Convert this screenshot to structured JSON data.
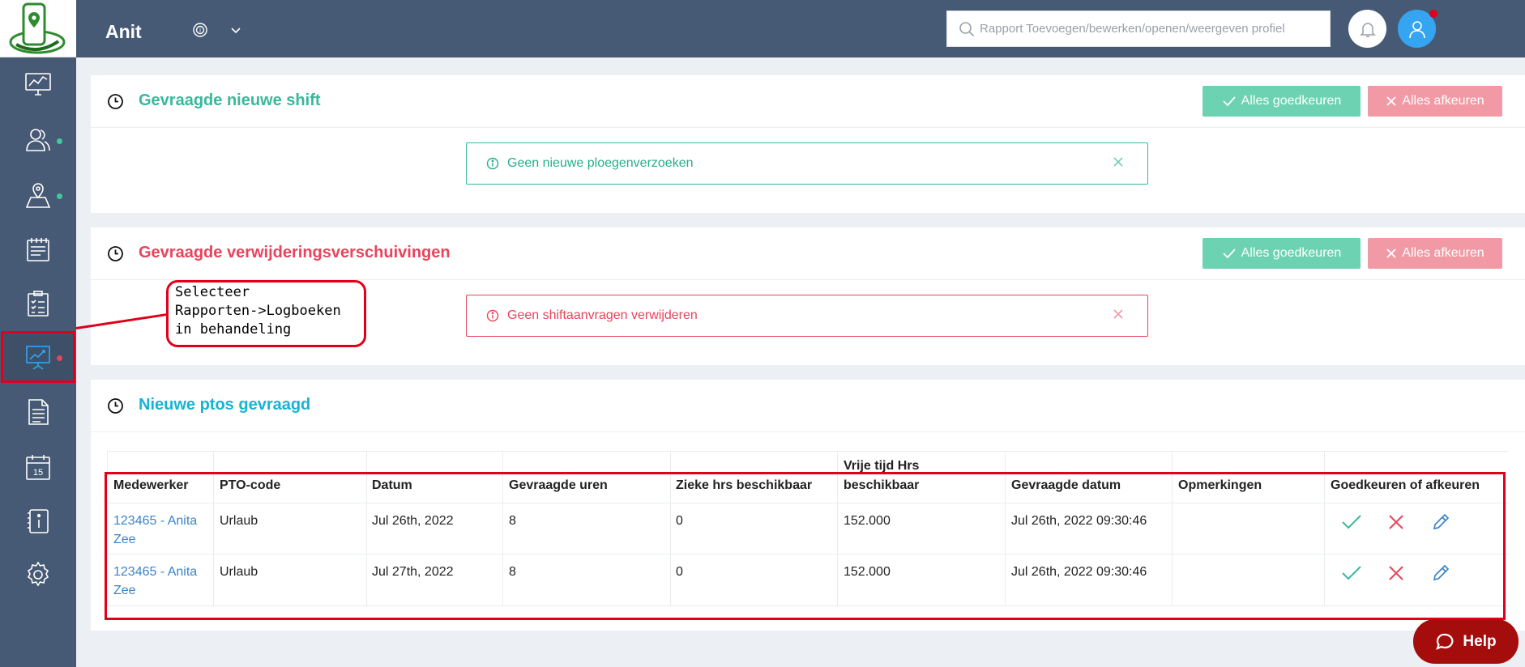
{
  "app": {
    "title": "Anit"
  },
  "search": {
    "placeholder": "Rapport Toevoegen/bewerken/openen/weergeven profiel"
  },
  "sidebar": {
    "items": [
      {
        "name": "dashboard",
        "icon": "monitor-chart-icon"
      },
      {
        "name": "users",
        "icon": "users-icon",
        "dot": "#3ecba0"
      },
      {
        "name": "locations",
        "icon": "map-pin-icon",
        "dot": "#3ecba0"
      },
      {
        "name": "schedule",
        "icon": "clipboard-calendar-icon"
      },
      {
        "name": "tasks",
        "icon": "checklist-icon"
      },
      {
        "name": "reports",
        "icon": "presentation-chart-icon",
        "dot": "#e8445c",
        "active": true
      },
      {
        "name": "documents",
        "icon": "document-icon"
      },
      {
        "name": "calendar",
        "icon": "calendar-icon",
        "day": "15"
      },
      {
        "name": "info",
        "icon": "info-book-icon"
      },
      {
        "name": "settings",
        "icon": "gear-icon"
      }
    ]
  },
  "cards": [
    {
      "title": "Gevraagde nieuwe shift",
      "title_color": "#3ab89c",
      "approve_label": "Alles goedkeuren",
      "reject_label": "Alles afkeuren",
      "alert": {
        "text": "Geen nieuwe ploegenverzoeken",
        "color": "#27ae8a"
      }
    },
    {
      "title": "Gevraagde verwijderingsverschuivingen",
      "title_color": "#e8445c",
      "approve_label": "Alles goedkeuren",
      "reject_label": "Alles afkeuren",
      "alert": {
        "text": "Geen shiftaanvragen verwijderen",
        "color": "#e8445c"
      }
    },
    {
      "title": "Nieuwe ptos gevraagd",
      "title_color": "#17b3d4"
    }
  ],
  "pto_table": {
    "headers": {
      "employee": "Medewerker",
      "pto_code": "PTO-code",
      "date": "Datum",
      "hours_requested": "Gevraagde uren",
      "sick_hours": "Zieke hrs beschikbaar",
      "free_hours_line1": "Vrije tijd Hrs",
      "free_hours_line2": "beschikbaar",
      "requested_date": "Gevraagde datum",
      "remarks": "Opmerkingen",
      "actions": "Goedkeuren of afkeuren"
    },
    "rows": [
      {
        "employee_line1": "123465 - Anita",
        "employee_line2": "Zee",
        "pto_code": "Urlaub",
        "date": "Jul 26th, 2022",
        "hours_requested": "8",
        "sick_hours": "0",
        "free_hours": "152.000",
        "requested_date": "Jul 26th, 2022 09:30:46",
        "remarks": ""
      },
      {
        "employee_line1": "123465 - Anita",
        "employee_line2": "Zee",
        "pto_code": "Urlaub",
        "date": "Jul 27th, 2022",
        "hours_requested": "8",
        "sick_hours": "0",
        "free_hours": "152.000",
        "requested_date": "Jul 26th, 2022 09:30:46",
        "remarks": ""
      }
    ]
  },
  "annotation": {
    "text": "Selecteer\nRapporten->Logboeken\nin behandeling"
  },
  "help": {
    "label": "Help"
  },
  "colors": {
    "sidebar": "#475a75",
    "approve": "#6dd2b1",
    "reject": "#f19aa5",
    "highlight": "#e0001a",
    "link": "#3a84c9"
  }
}
